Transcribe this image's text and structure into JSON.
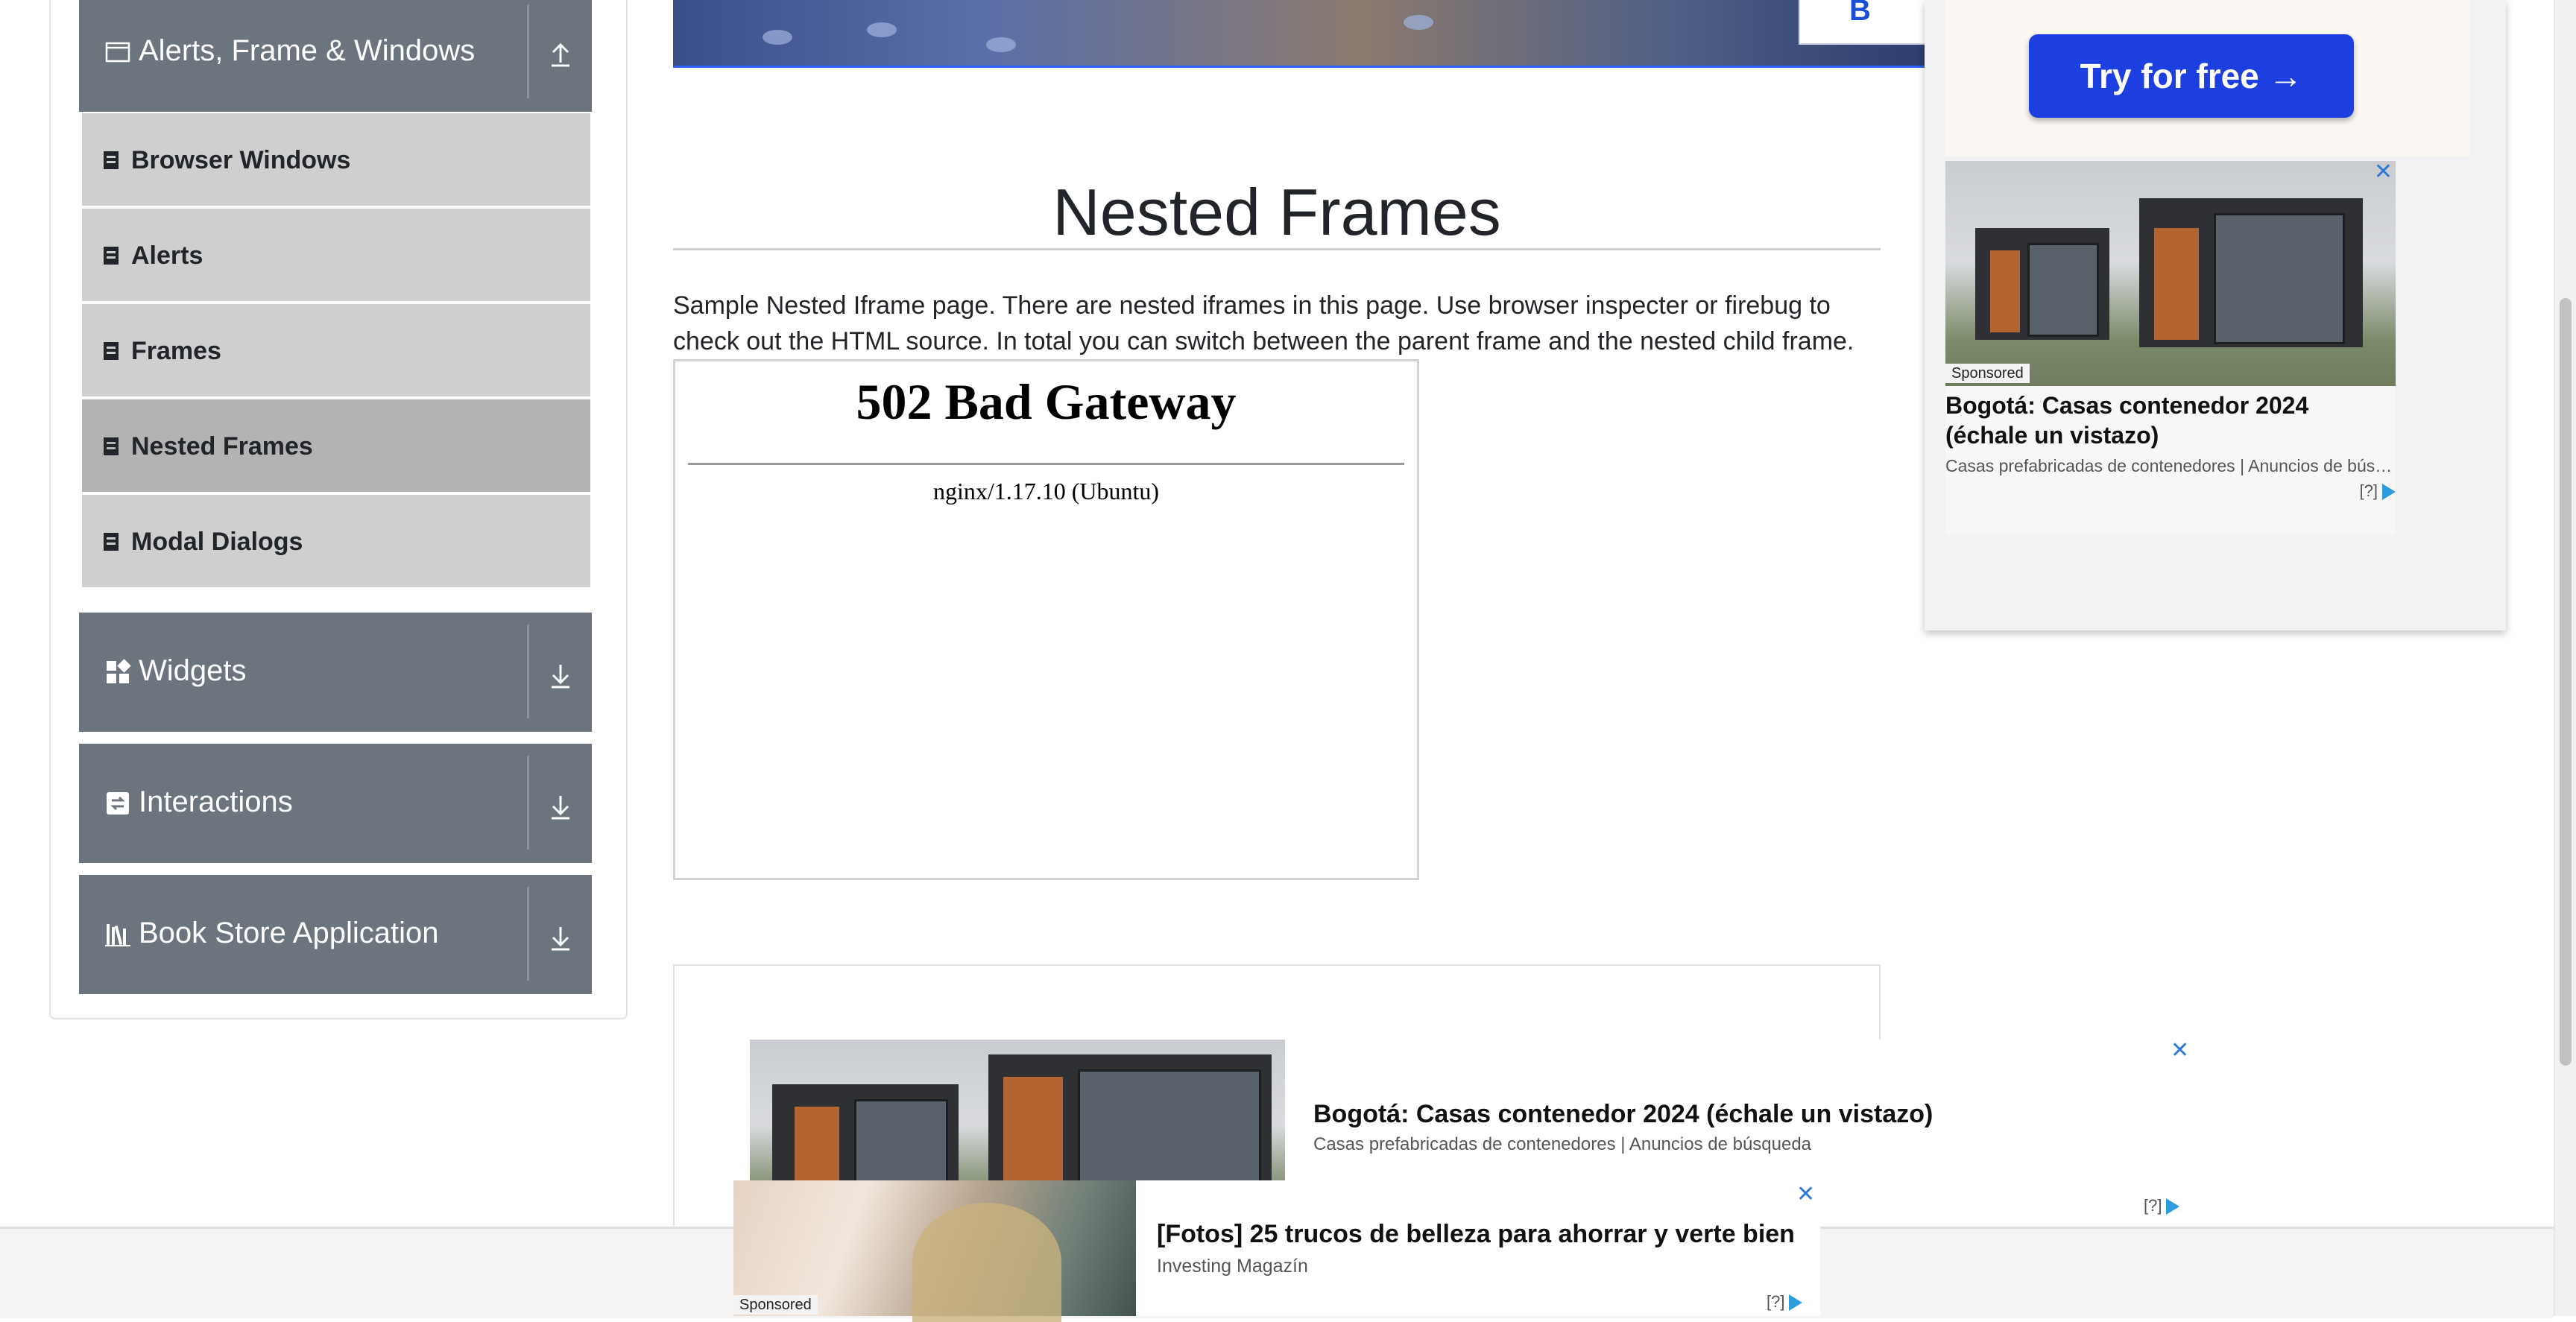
{
  "sidebar": {
    "groups": [
      {
        "title": "Alerts, Frame & Windows",
        "icon": "window-icon",
        "arrow": "collapse-up-arrow"
      },
      {
        "title": "Widgets",
        "icon": "widgets-icon",
        "arrow": "expand-down-arrow"
      },
      {
        "title": "Interactions",
        "icon": "interactions-icon",
        "arrow": "expand-down-arrow"
      },
      {
        "title": "Book Store Application",
        "icon": "books-icon",
        "arrow": "expand-down-arrow"
      }
    ],
    "items": [
      {
        "label": "Browser Windows",
        "active": false
      },
      {
        "label": "Alerts",
        "active": false
      },
      {
        "label": "Frames",
        "active": false
      },
      {
        "label": "Nested Frames",
        "active": true
      },
      {
        "label": "Modal Dialogs",
        "active": false
      }
    ]
  },
  "main": {
    "title": "Nested Frames",
    "description": "Sample Nested Iframe page. There are nested iframes in this page. Use browser inspecter or firebug to check out the HTML source. In total you can switch between the parent frame and the nested child frame.",
    "iframe": {
      "error_title": "502 Bad Gateway",
      "server": "nginx/1.17.10 (Ubuntu)"
    },
    "banner_partial_text": "B"
  },
  "ads": {
    "side": {
      "cta": "Try for free →",
      "sponsored": "Sponsored",
      "headline": "Bogotá: Casas contenedor 2024 (échale un vistazo)",
      "source": "Casas prefabricadas de contenedores | Anuncios de búsqueda",
      "adchoices": "[?]",
      "close": "✕"
    },
    "middle": {
      "headline": "Bogotá: Casas contenedor 2024 (échale un vistazo)",
      "source": "Casas prefabricadas de contenedores | Anuncios de búsqueda",
      "adchoices": "[?]",
      "close": "✕"
    },
    "bottom": {
      "sponsored": "Sponsored",
      "headline": "[Fotos] 25 trucos de belleza para ahorrar y verte bien",
      "source": "Investing Magazín",
      "adchoices": "[?]",
      "close": "✕"
    }
  },
  "colors": {
    "group_header_bg": "#6c757d",
    "menu_item_bg": "#cfcfcf",
    "menu_item_active_bg": "#b3b3b3",
    "cta_blue": "#1d3fe0",
    "adchoices_blue": "#2d9cdb"
  }
}
